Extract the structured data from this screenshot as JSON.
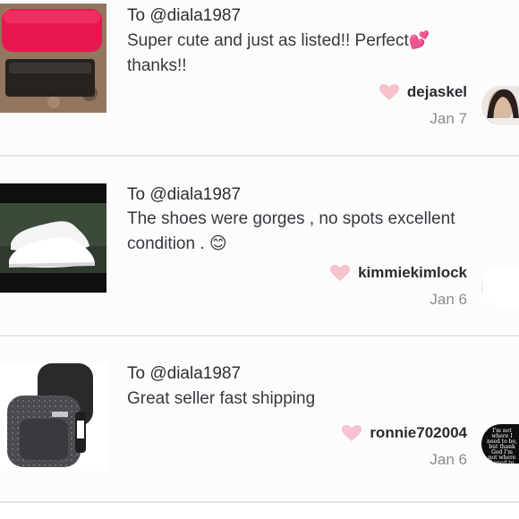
{
  "reviews": [
    {
      "to": "To @diala1987",
      "message": "Super cute and just as listed!! Perfect💕 thanks!!",
      "username": "dejaskel",
      "date": "Jan 7",
      "thumb_icon": "pink-glasses-case-photo",
      "avatar_icon": "user-photo-avatar"
    },
    {
      "to": "To @diala1987",
      "message": "The shoes were gorges , no spots excellent condition . 😊",
      "username": "kimmiekimlock",
      "date": "Jan 6",
      "thumb_icon": "white-sneakers-photo",
      "avatar_icon": "blank-avatar"
    },
    {
      "to": "To @diala1987",
      "message": "Great seller fast shipping",
      "username": "ronnie702004",
      "date": "Jan 6",
      "thumb_icon": "backpack-photo",
      "avatar_icon": "quote-text-avatar",
      "avatar_text": "I'm not where I need to be, but thank God I'm not where I used to be."
    }
  ],
  "colors": {
    "heart": "#f7c3cc",
    "divider": "#e4e3e6",
    "text": "#38383f",
    "muted": "#8a8a90"
  }
}
